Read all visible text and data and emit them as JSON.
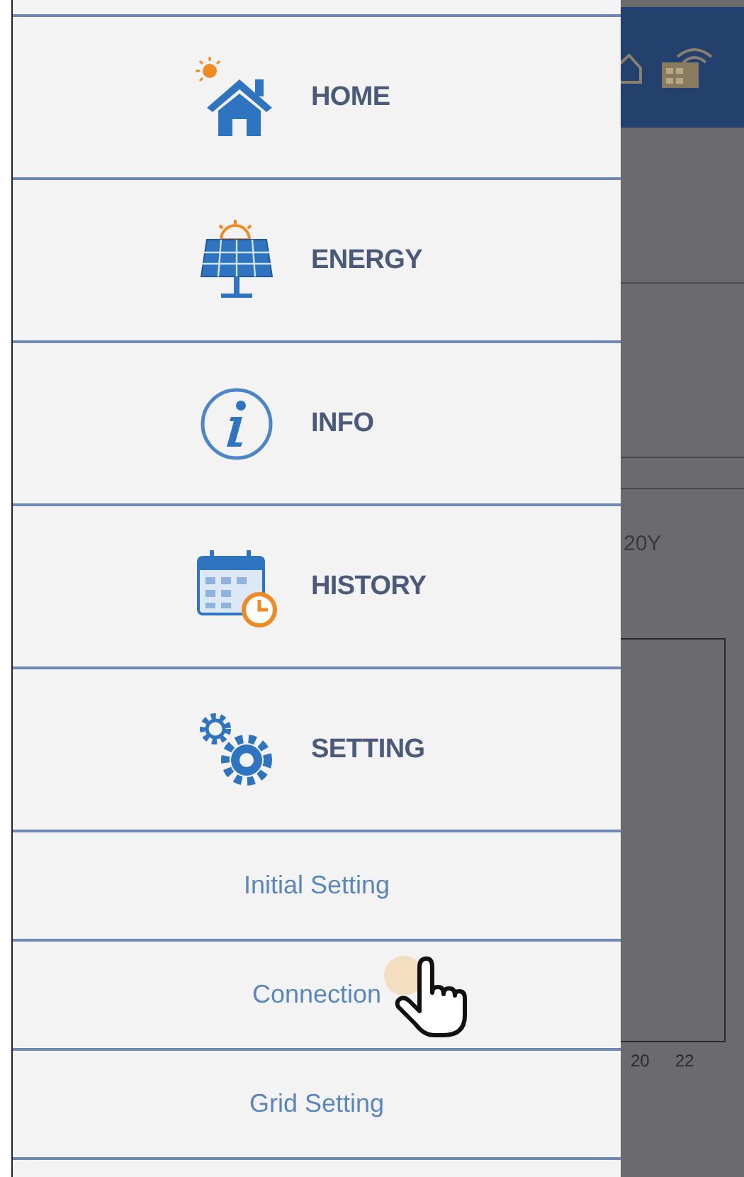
{
  "drawer": {
    "items": [
      {
        "kind": "main",
        "label": "HOME"
      },
      {
        "kind": "main",
        "label": "ENERGY"
      },
      {
        "kind": "main",
        "label": "INFO"
      },
      {
        "kind": "main",
        "label": "HISTORY"
      },
      {
        "kind": "main",
        "label": "SETTING"
      },
      {
        "kind": "sub",
        "label": "Initial Setting"
      },
      {
        "kind": "sub",
        "label": "Connection"
      },
      {
        "kind": "sub",
        "label": "Grid Setting"
      }
    ]
  },
  "background": {
    "label": "20Y",
    "axis_ticks": [
      "20",
      "22"
    ]
  }
}
